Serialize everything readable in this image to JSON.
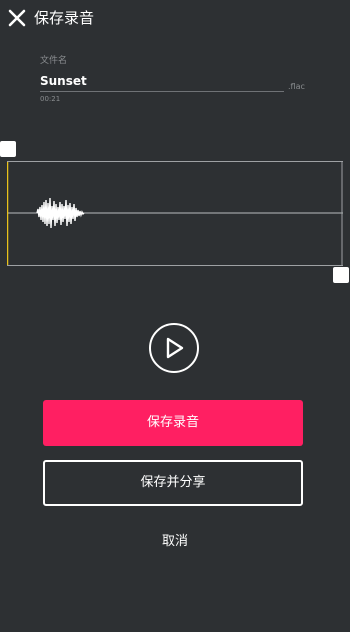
{
  "header": {
    "title": "保存录音",
    "close_icon": "close-icon"
  },
  "file": {
    "label": "文件名",
    "name": "Sunset",
    "extension": ".flac",
    "duration": "00:21"
  },
  "player": {
    "play_icon": "play-icon"
  },
  "actions": {
    "save_label": "保存录音",
    "save_share_label": "保存并分享",
    "cancel_label": "取消"
  },
  "colors": {
    "background": "#2d3033",
    "accent": "#ff1f62",
    "playhead": "#e8c21a"
  }
}
